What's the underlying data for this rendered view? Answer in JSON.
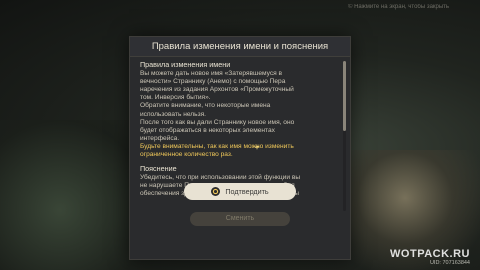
{
  "dialog": {
    "title": "Правила изменения имени и пояснения"
  },
  "rules": {
    "heading": "Правила изменения имени",
    "p1": "Вы можете дать новое имя «Затерявшемуся в\nвечности» Страннику (Анемо) с помощью Пера\nнаречения из задания Архонтов «Промежуточный\nтом. Инверсия бытия».",
    "p2": "Обратите внимание, что некоторые имена\nиспользовать нельзя.",
    "p3": "После того как вы дали Страннику новое имя, оно\nбудет отображаться в некоторых элементах\nинтерфейса.",
    "p4": "Будьте внимательны, так как имя можно изменить\nограниченное количество раз."
  },
  "explanation": {
    "heading": "Пояснение",
    "p1": "Убедитесь, что при использовании этой функции вы\nне нарушаете Пользовательское соглашение. Для\nобеспечения здоровой и позитивной игровой среды"
  },
  "buttons": {
    "confirm_label": "Подтвердить",
    "ghost_label": "Сменить"
  },
  "top_hint": "© Нажмите на экран, чтобы закрыть",
  "watermark": {
    "logo": "WOTPACK.RU",
    "uid": "UID: 707163844"
  },
  "colors": {
    "highlight": "#f0c85a",
    "dialog_bg": "#2a2b2d",
    "button_bg": "#e8e2d3"
  },
  "icons": {
    "confirm": "circle-icon",
    "sparkle": "sparkle-icon"
  }
}
